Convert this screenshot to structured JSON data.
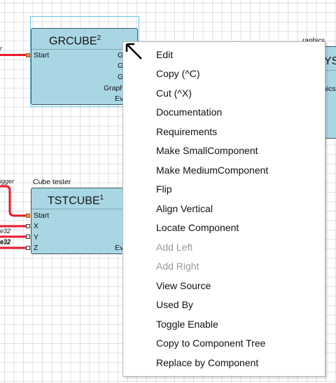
{
  "grcube": {
    "title": "GRCUBE",
    "superscript": "2",
    "input_label": "Start",
    "right_labels": [
      "G",
      "G",
      "G",
      "Graph",
      "Ev"
    ],
    "incoming_wire_label": "r"
  },
  "tstcube": {
    "caption": "Cube tester",
    "title": "TSTCUBE",
    "superscript": "1",
    "inputs": [
      "Start",
      "X",
      "Y",
      "Z"
    ],
    "right_label": "Ev",
    "wire_labels": [
      "igger",
      "e32",
      "e32",
      "e32"
    ]
  },
  "partial_block": {
    "top_label": "raphics",
    "title_fragment": "YSC",
    "side_label": "nics"
  },
  "context_menu": {
    "items": [
      {
        "label": "Edit",
        "enabled": true
      },
      {
        "label": "Copy (^C)",
        "enabled": true
      },
      {
        "label": "Cut (^X)",
        "enabled": true
      },
      {
        "label": "Documentation",
        "enabled": true
      },
      {
        "label": "Requirements",
        "enabled": true
      },
      {
        "label": "Make SmallComponent",
        "enabled": true
      },
      {
        "label": "Make MediumComponent",
        "enabled": true
      },
      {
        "label": "Flip",
        "enabled": true
      },
      {
        "label": "Align Vertical",
        "enabled": true
      },
      {
        "label": "Locate Component",
        "enabled": true
      },
      {
        "label": "Add Left",
        "enabled": false
      },
      {
        "label": "Add Right",
        "enabled": false
      },
      {
        "label": "View Source",
        "enabled": true
      },
      {
        "label": "Used By",
        "enabled": true
      },
      {
        "label": "Toggle Enable",
        "enabled": true
      },
      {
        "label": "Copy to Component Tree",
        "enabled": true
      },
      {
        "label": "Replace by Component",
        "enabled": true
      }
    ]
  },
  "colors": {
    "block_fill": "#a9d6e3",
    "wire": "#e8192c",
    "port_active": "#f7931e",
    "selection": "#6cc6ec",
    "disabled_text": "#9a9a9a"
  }
}
